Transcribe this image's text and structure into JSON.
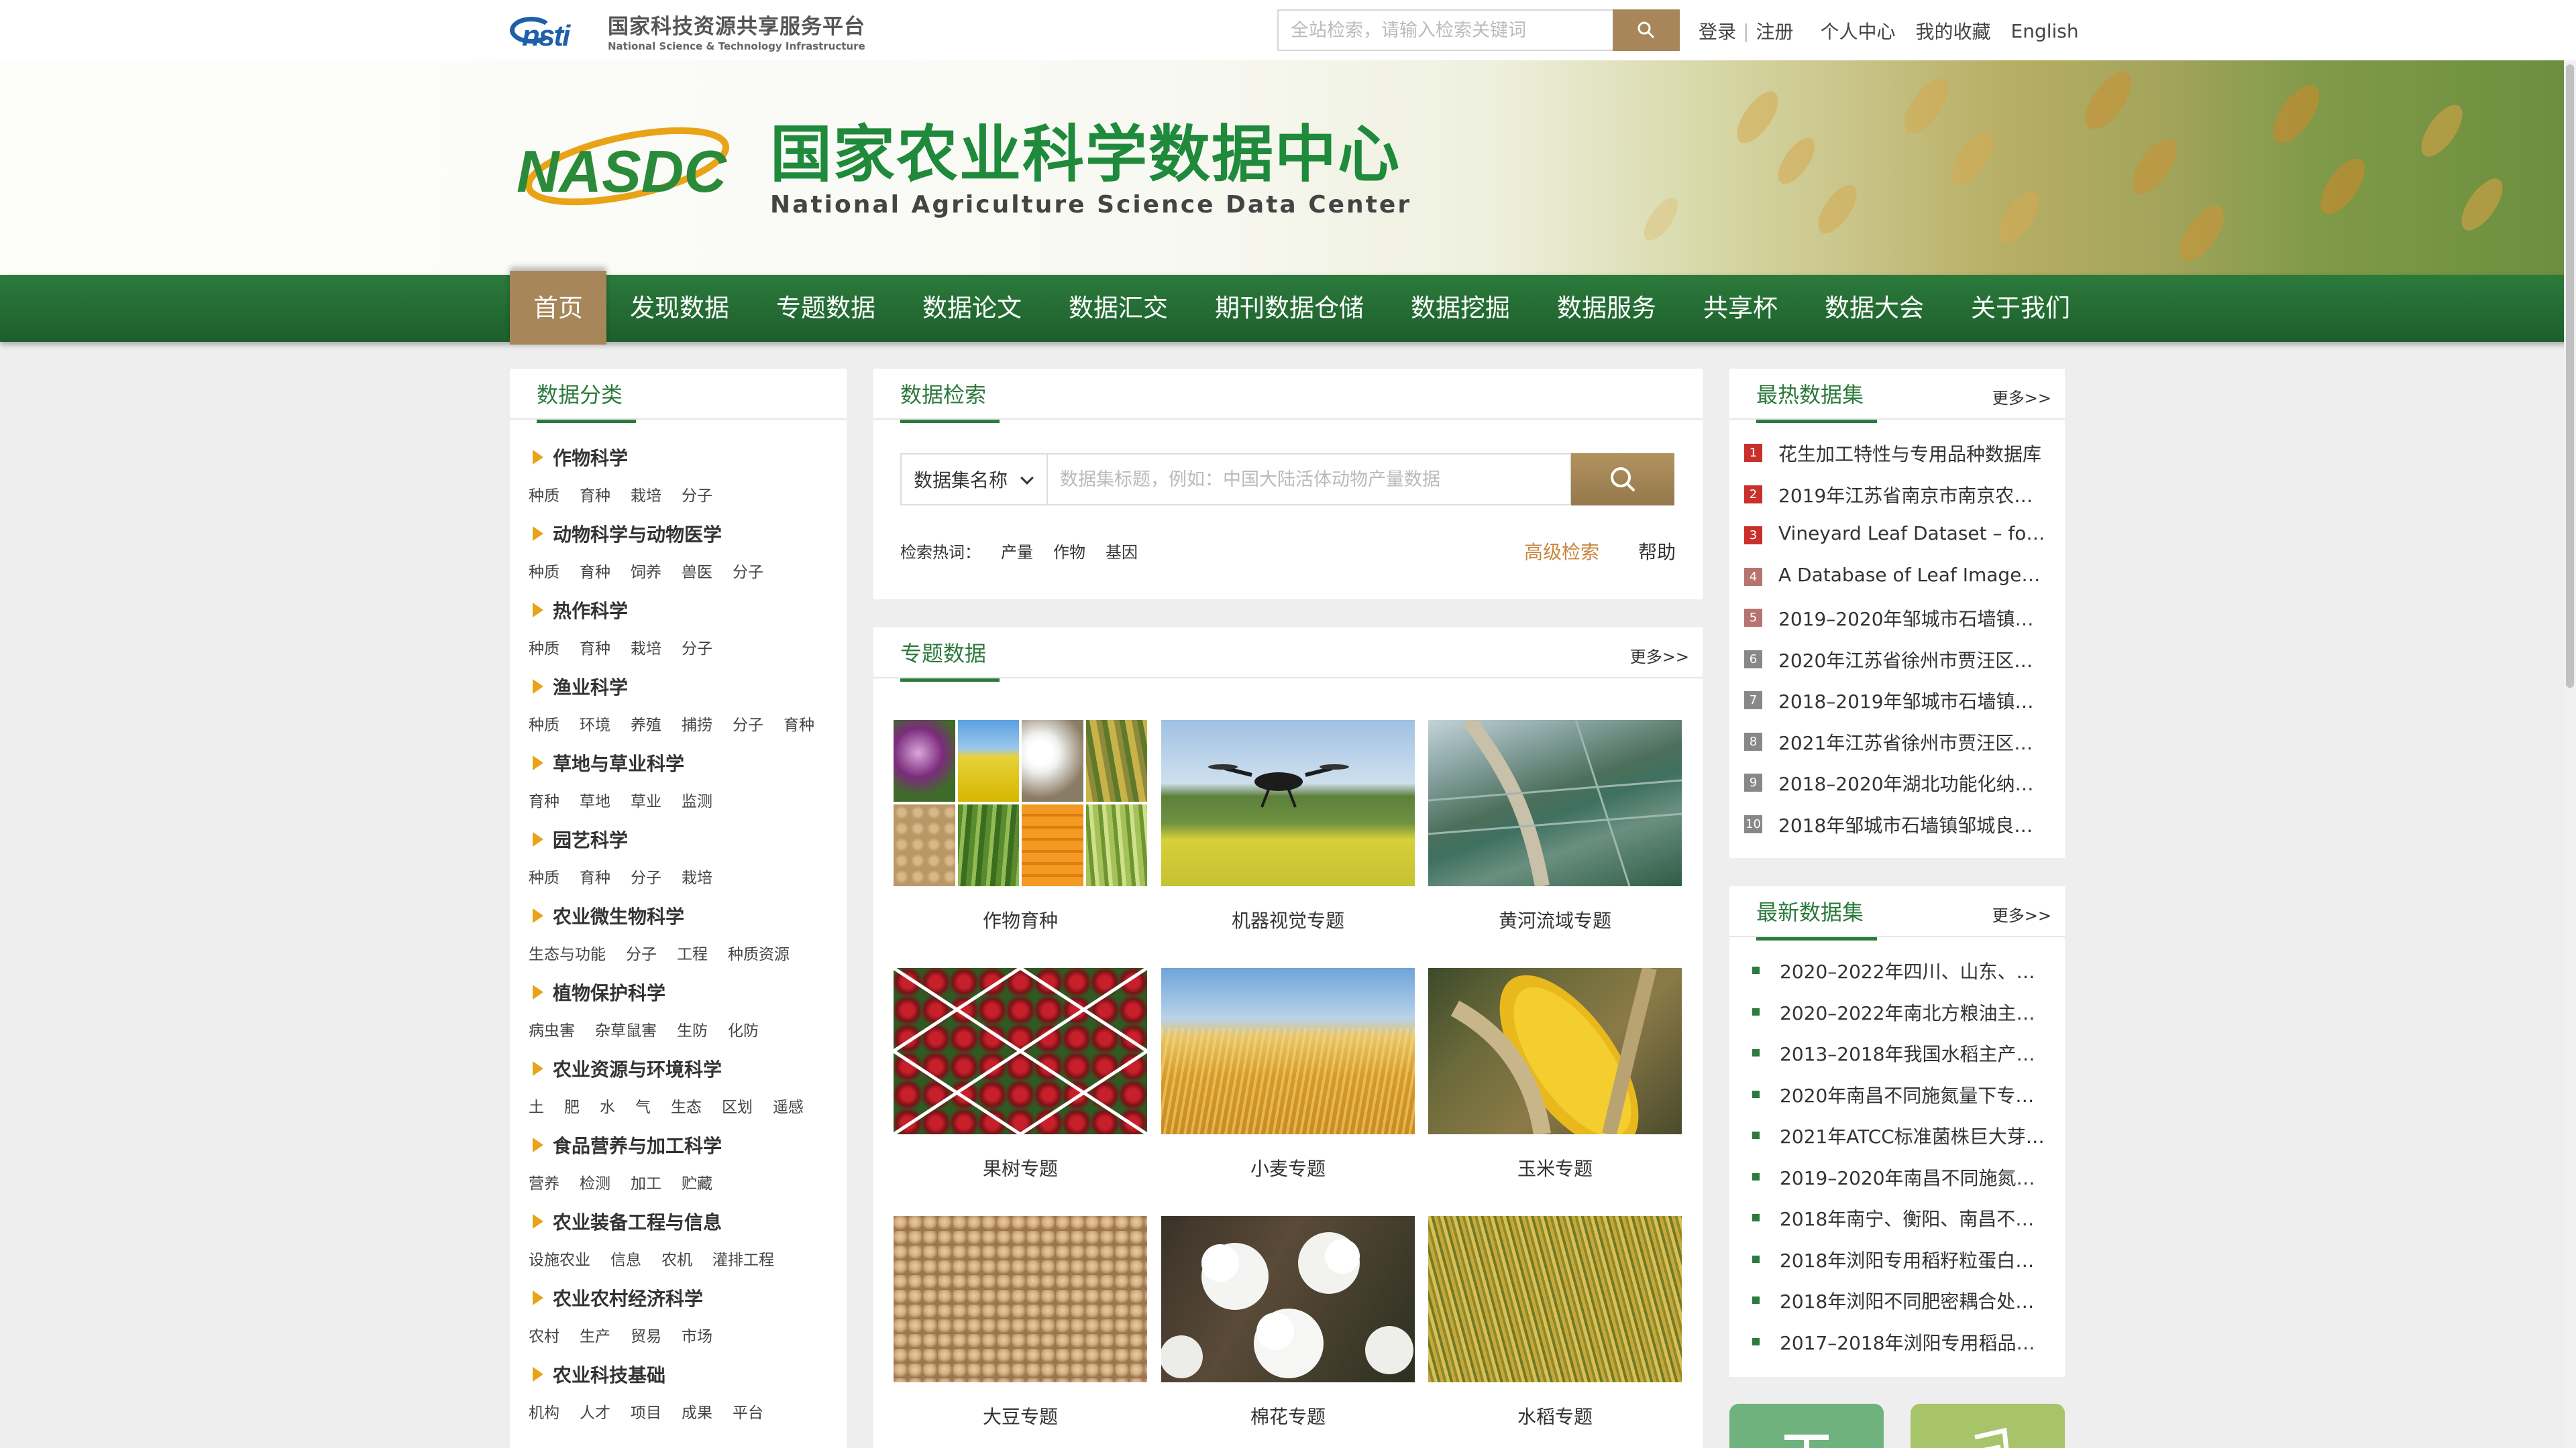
{
  "topbar": {
    "nsti_logo_text": "nsti",
    "platform_cn": "国家科技资源共享服务平台",
    "platform_en": "National Science & Technology Infrastructure",
    "search_placeholder": "全站检索，请输入检索关键词",
    "links": {
      "login": "登录",
      "register": "注册",
      "personal": "个人中心",
      "favorites": "我的收藏",
      "english": "English"
    }
  },
  "banner": {
    "logo_text": "NASDC",
    "title_cn": "国家农业科学数据中心",
    "title_en": "National Agriculture Science Data Center"
  },
  "nav": [
    "首页",
    "发现数据",
    "专题数据",
    "数据论文",
    "数据汇交",
    "期刊数据仓储",
    "数据挖掘",
    "数据服务",
    "共享杯",
    "数据大会",
    "关于我们"
  ],
  "categories": {
    "title": "数据分类",
    "items": [
      {
        "name": "作物科学",
        "subs": [
          "种质",
          "育种",
          "栽培",
          "分子"
        ]
      },
      {
        "name": "动物科学与动物医学",
        "subs": [
          "种质",
          "育种",
          "饲养",
          "兽医",
          "分子"
        ]
      },
      {
        "name": "热作科学",
        "subs": [
          "种质",
          "育种",
          "栽培",
          "分子"
        ]
      },
      {
        "name": "渔业科学",
        "subs": [
          "种质",
          "环境",
          "养殖",
          "捕捞",
          "分子",
          "育种"
        ]
      },
      {
        "name": "草地与草业科学",
        "subs": [
          "育种",
          "草地",
          "草业",
          "监测"
        ]
      },
      {
        "name": "园艺科学",
        "subs": [
          "种质",
          "育种",
          "分子",
          "栽培"
        ]
      },
      {
        "name": "农业微生物科学",
        "subs": [
          "生态与功能",
          "分子",
          "工程",
          "种质资源"
        ]
      },
      {
        "name": "植物保护科学",
        "subs": [
          "病虫害",
          "杂草鼠害",
          "生防",
          "化防"
        ]
      },
      {
        "name": "农业资源与环境科学",
        "subs": [
          "土",
          "肥",
          "水",
          "气",
          "生态",
          "区划",
          "遥感"
        ]
      },
      {
        "name": "食品营养与加工科学",
        "subs": [
          "营养",
          "检测",
          "加工",
          "贮藏"
        ]
      },
      {
        "name": "农业装备工程与信息",
        "subs": [
          "设施农业",
          "信息",
          "农机",
          "灌排工程"
        ]
      },
      {
        "name": "农业农村经济科学",
        "subs": [
          "农村",
          "生产",
          "贸易",
          "市场"
        ]
      },
      {
        "name": "农业科技基础",
        "subs": [
          "机构",
          "人才",
          "项目",
          "成果",
          "平台"
        ]
      }
    ]
  },
  "search": {
    "title": "数据检索",
    "select_value": "数据集名称",
    "placeholder": "数据集标题，例如：中国大陆活体动物产量数据",
    "hot_label": "检索热词：",
    "hot_words": [
      "产量",
      "作物",
      "基因"
    ],
    "advanced": "高级检索",
    "help": "帮助"
  },
  "topics": {
    "title": "专题数据",
    "more": "更多>>",
    "items": [
      "作物育种",
      "机器视觉专题",
      "黄河流域专题",
      "果树专题",
      "小麦专题",
      "玉米专题",
      "大豆专题",
      "棉花专题",
      "水稻专题"
    ]
  },
  "hot_datasets": {
    "title": "最热数据集",
    "more": "更多>>",
    "items": [
      "花生加工特性与专用品种数据库",
      "2019年江苏省南京市南京农业…",
      "Vineyard Leaf Dataset – for …",
      "A Database of Leaf Images: …",
      "2019–2020年邹城市石墙镇邹…",
      "2020年江苏省徐州市贾汪区泉…",
      "2018–2019年邹城市石墙镇邹…",
      "2021年江苏省徐州市贾汪区泉…",
      "2018–2020年湖北功能化纳米…",
      "2018年邹城市石墙镇邹城良种…"
    ],
    "colors": [
      "#c9302c",
      "#c9302c",
      "#c9302c",
      "#b5746f",
      "#b5746f",
      "#888888",
      "#888888",
      "#888888",
      "#888888",
      "#888888"
    ]
  },
  "new_datasets": {
    "title": "最新数据集",
    "more": "更多>>",
    "items": [
      "2020–2022年四川、山东、黑…",
      "2020–2022年南北方粮油主产…",
      "2013–2018年我国水稻主产区…",
      "2020年南昌不同施氮量下专用…",
      "2021年ATCC标准菌株巨大芽…",
      "2019–2020年南昌不同施氮量…",
      "2018年南宁、衡阳、南昌不同…",
      "2018年浏阳专用稻籽粒蛋白质…",
      "2018年浏阳不同肥密耦合处理…",
      "2017–2018年浏阳专用稻品种…"
    ]
  },
  "colors": {
    "green": "#2c7a3c",
    "gold": "#a7875a"
  }
}
